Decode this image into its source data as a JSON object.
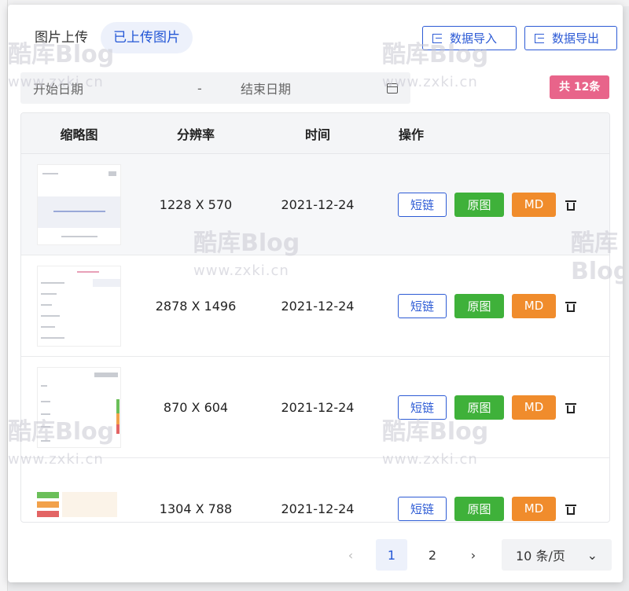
{
  "tabs": [
    {
      "label": "图片上传",
      "active": false
    },
    {
      "label": "已上传图片",
      "active": true
    }
  ],
  "toolbar": {
    "import_label": "数据导入",
    "export_label": "数据导出"
  },
  "date_filter": {
    "start_placeholder": "开始日期",
    "separator": "-",
    "end_placeholder": "结束日期"
  },
  "count_badge": "共 12条",
  "table": {
    "headers": {
      "thumb": "缩略图",
      "resolution": "分辨率",
      "time": "时间",
      "actions": "操作"
    },
    "rows": [
      {
        "resolution": "1228 X 570",
        "time": "2021-12-24"
      },
      {
        "resolution": "2878 X 1496",
        "time": "2021-12-24"
      },
      {
        "resolution": "870 X 604",
        "time": "2021-12-24"
      },
      {
        "resolution": "1304 X 788",
        "time": "2021-12-24"
      }
    ],
    "action_labels": {
      "short_link": "短链",
      "original": "原图",
      "markdown": "MD"
    }
  },
  "pagination": {
    "prev": "‹",
    "pages": [
      "1",
      "2"
    ],
    "current": "1",
    "next": "›",
    "page_size": "10 条/页"
  },
  "watermark": {
    "brand": "酷库Blog",
    "site": "www.zxki.cn"
  },
  "colors": {
    "primary": "#2d5bd5",
    "success": "#3fb13a",
    "warning": "#f08c2c",
    "badge": "#e8648a"
  }
}
